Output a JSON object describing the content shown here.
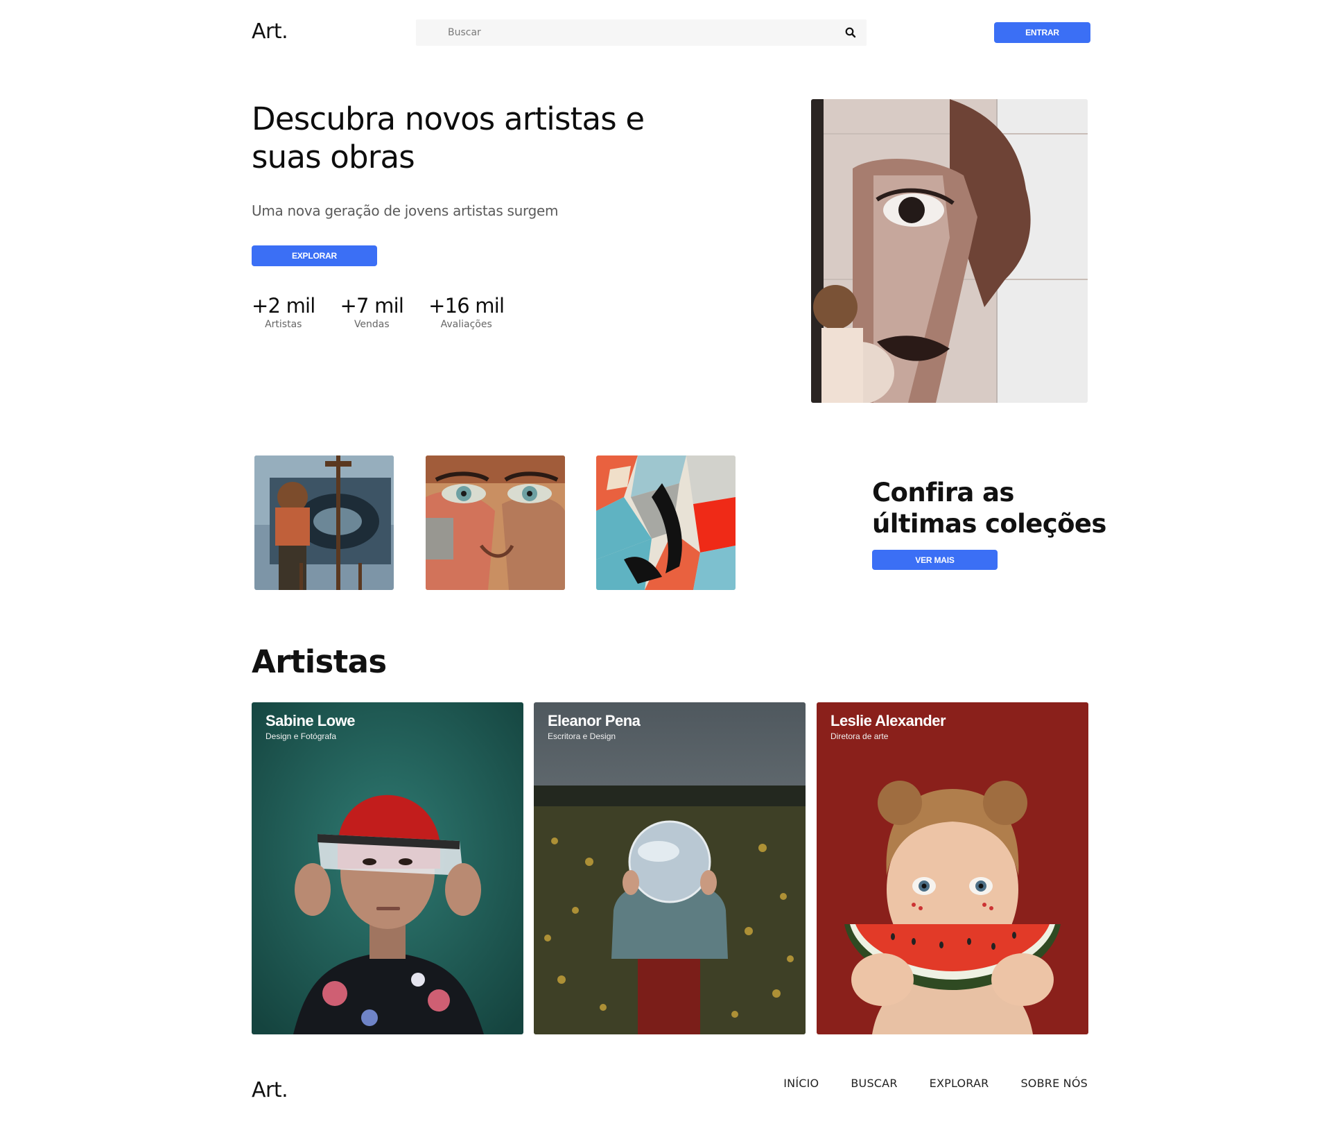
{
  "header": {
    "logo": "Art.",
    "search_placeholder": "Buscar",
    "login_label": "ENTRAR"
  },
  "hero": {
    "title": "Descubra novos artistas e suas obras",
    "subtitle": "Uma nova geração de jovens artistas surgem",
    "explore_label": "EXPLORAR",
    "stats": [
      {
        "value": "+2 mil",
        "label": "Artistas"
      },
      {
        "value": "+7 mil",
        "label": "Vendas"
      },
      {
        "value": "+16 mil",
        "label": "Avaliações"
      }
    ]
  },
  "collections": {
    "title": "Confira as últimas coleções",
    "more_label": "VER MAIS"
  },
  "artists": {
    "heading": "Artistas",
    "cards": [
      {
        "name": "Sabine Lowe",
        "role": "Design e Fotógrafa"
      },
      {
        "name": "Eleanor Pena",
        "role": "Escritora e Design"
      },
      {
        "name": "Leslie Alexander",
        "role": "Diretora de arte"
      }
    ]
  },
  "footer": {
    "logo": "Art.",
    "nav": [
      "INÍCIO",
      "BUSCAR",
      "EXPLORAR",
      "SOBRE NÓS"
    ]
  },
  "colors": {
    "accent": "#3b6ff5",
    "card_teal": "#1d5650",
    "card_gray": "#4a5257",
    "card_red": "#8c1f1a"
  }
}
